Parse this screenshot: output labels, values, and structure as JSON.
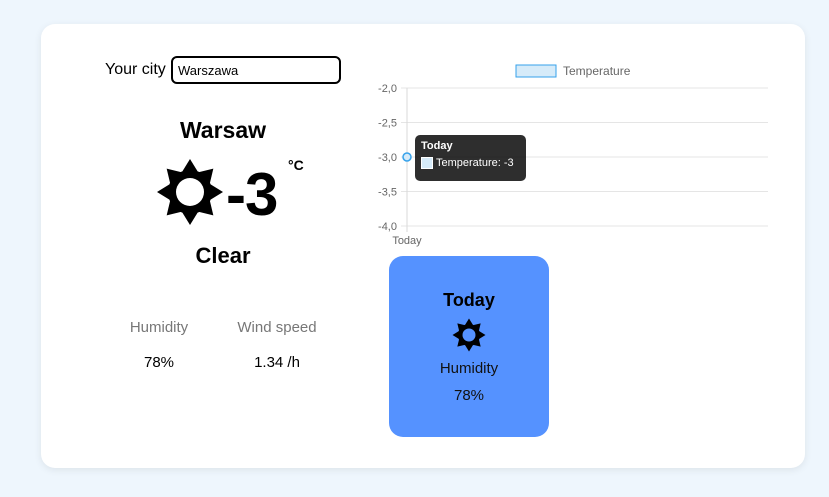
{
  "search": {
    "label": "Your city",
    "value": "Warszawa"
  },
  "current": {
    "city": "Warsaw",
    "temperature": "-3",
    "unit": "°C",
    "condition": "Clear",
    "icon": "sun-icon",
    "humidity_label": "Humidity",
    "humidity_value": "78%",
    "wind_label": "Wind speed",
    "wind_value": "1.34 /h"
  },
  "chart_data": {
    "type": "line",
    "categories": [
      "Today"
    ],
    "series": [
      {
        "name": "Temperature",
        "values": [
          -3
        ]
      }
    ],
    "ylim": [
      -4,
      -2
    ],
    "yticks": [
      "-2,0",
      "-2,5",
      "-3,0",
      "-3,5",
      "-4,0"
    ],
    "grid": true,
    "legend": "top",
    "colors": {
      "fill": "#d6ebf9",
      "stroke": "#36a2eb"
    },
    "tooltip": {
      "title": "Today",
      "label": "Temperature: -3"
    }
  },
  "forecast": [
    {
      "day": "Today",
      "icon": "sun-icon",
      "humidity_label": "Humidity",
      "humidity_value": "78%"
    }
  ],
  "colors": {
    "background": "#eef6fd",
    "card": "#ffffff",
    "forecast_card": "#5592ff"
  }
}
